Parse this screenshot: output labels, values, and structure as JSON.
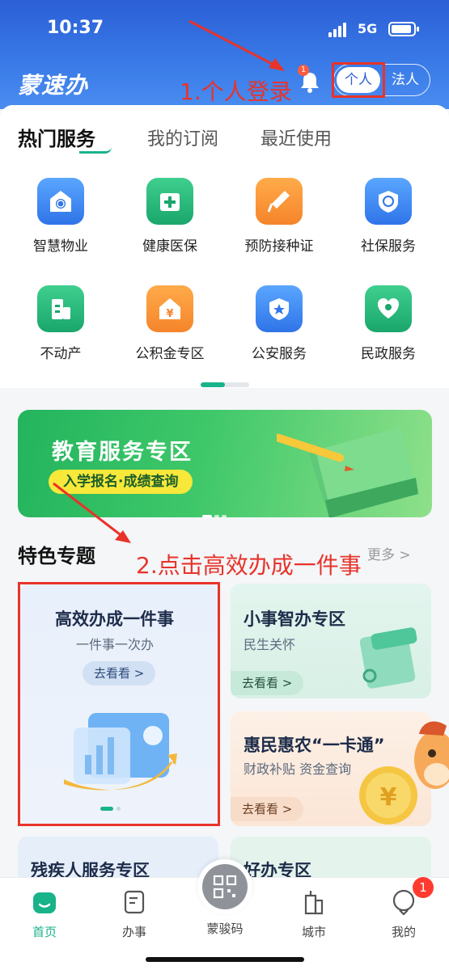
{
  "status_bar": {
    "time": "10:37",
    "network": "5G"
  },
  "header": {
    "logo": "蒙速办",
    "notification_count": "1",
    "toggle_personal": "个人",
    "toggle_legal": "法人"
  },
  "tabs": [
    {
      "label": "热门服务"
    },
    {
      "label": "我的订阅"
    },
    {
      "label": "最近使用"
    }
  ],
  "services": [
    {
      "label": "智慧物业",
      "icon": "smart-property-icon"
    },
    {
      "label": "健康医保",
      "icon": "medical-insurance-icon"
    },
    {
      "label": "预防接种证",
      "icon": "vaccine-icon"
    },
    {
      "label": "社保服务",
      "icon": "social-security-icon"
    },
    {
      "label": "不动产",
      "icon": "real-estate-icon"
    },
    {
      "label": "公积金专区",
      "icon": "housing-fund-icon"
    },
    {
      "label": "公安服务",
      "icon": "police-icon"
    },
    {
      "label": "民政服务",
      "icon": "civil-affairs-icon"
    }
  ],
  "banner": {
    "title": "教育服务专区",
    "pill": "入学报名·成绩查询"
  },
  "features": {
    "title": "特色专题",
    "more": "更多 >",
    "cards": [
      {
        "title": "高效办成一件事",
        "subtitle": "一件事一次办",
        "button": "去看看 >"
      },
      {
        "title": "小事智办专区",
        "subtitle": "民生关怀",
        "button": "去看看 >"
      },
      {
        "title": "惠民惠农“一卡通”",
        "subtitle": "财政补贴 资金查询",
        "button": "去看看 >"
      },
      {
        "title": "残疾人服务专区"
      },
      {
        "title": "好办专区"
      }
    ]
  },
  "annotations": {
    "step1": "1.个人登录",
    "step2": "2.点击高效办成一件事"
  },
  "bottom_nav": [
    {
      "label": "首页",
      "icon": "home-icon"
    },
    {
      "label": "办事",
      "icon": "affairs-icon"
    },
    {
      "label": "蒙骏码",
      "icon": "qr-code-icon"
    },
    {
      "label": "城市",
      "icon": "city-icon"
    },
    {
      "label": "我的",
      "icon": "profile-icon",
      "badge": "1"
    }
  ],
  "colors": {
    "accent": "#19b38a",
    "header": "#2b5fd6",
    "annotation": "#e8332a"
  }
}
